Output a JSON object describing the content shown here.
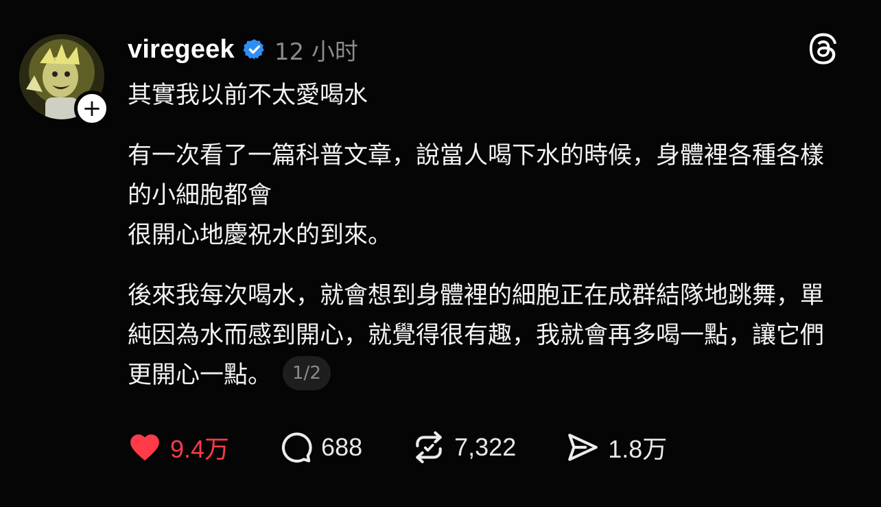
{
  "post": {
    "username": "viregeek",
    "timestamp": "12 小时",
    "first_line": "其實我以前不太愛喝水",
    "paragraphs": [
      "有一次看了一篇科普文章，說當人喝下水的時候，身體裡各種各樣的小細胞都會",
      "很開心地慶祝水的到來。",
      "後來我每次喝水，就會想到身體裡的細胞正在成群結隊地跳舞，單純因為水而感到開心，就覺得很有趣，我就會再多喝一點，讓它們更開心一點。"
    ],
    "page_indicator": "1/2"
  },
  "actions": {
    "likes": "9.4万",
    "comments": "688",
    "reposts": "7,322",
    "shares": "1.8万"
  },
  "colors": {
    "background": "#050505",
    "like_red": "#ff3b4a",
    "verified_blue": "#2f8ef5",
    "muted_text": "#8a8a8a"
  },
  "icons": [
    "threads-logo-icon",
    "verified-badge-icon",
    "heart-icon",
    "comment-icon",
    "repost-icon",
    "share-icon",
    "plus-icon"
  ]
}
